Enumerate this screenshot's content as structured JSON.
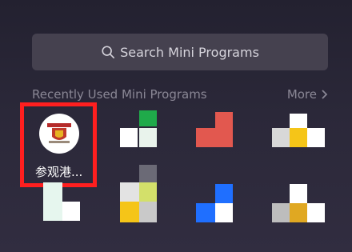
{
  "search": {
    "placeholder": "Search Mini Programs",
    "icon": "search-icon"
  },
  "recent": {
    "title": "Recently Used Mini Programs",
    "more_label": "More",
    "apps": [
      {
        "label": "参观港...",
        "icon": "university-crest-icon"
      }
    ]
  },
  "colors": {
    "background": "#2b2839",
    "search_bg": "#45414f",
    "highlight": "#ff1f1f",
    "green": "#1faa4a",
    "red": "#e2584f",
    "yellow": "#f5c518",
    "blue": "#1f6fff"
  }
}
